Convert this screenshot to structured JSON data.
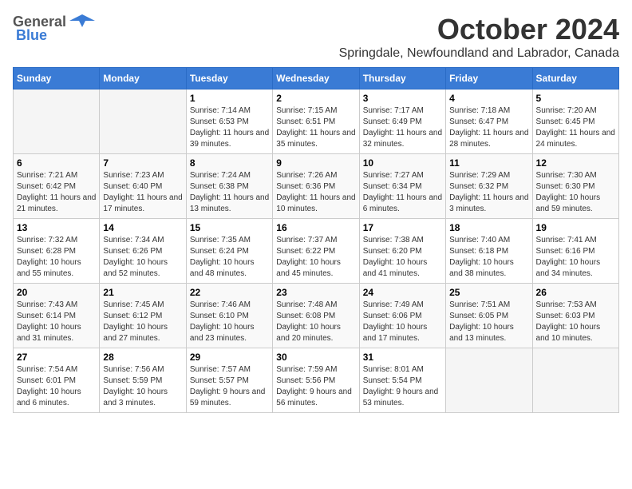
{
  "logo": {
    "general": "General",
    "blue": "Blue"
  },
  "title": "October 2024",
  "location": "Springdale, Newfoundland and Labrador, Canada",
  "days_header": [
    "Sunday",
    "Monday",
    "Tuesday",
    "Wednesday",
    "Thursday",
    "Friday",
    "Saturday"
  ],
  "weeks": [
    [
      {
        "day": "",
        "info": ""
      },
      {
        "day": "",
        "info": ""
      },
      {
        "day": "1",
        "info": "Sunrise: 7:14 AM\nSunset: 6:53 PM\nDaylight: 11 hours and 39 minutes."
      },
      {
        "day": "2",
        "info": "Sunrise: 7:15 AM\nSunset: 6:51 PM\nDaylight: 11 hours and 35 minutes."
      },
      {
        "day": "3",
        "info": "Sunrise: 7:17 AM\nSunset: 6:49 PM\nDaylight: 11 hours and 32 minutes."
      },
      {
        "day": "4",
        "info": "Sunrise: 7:18 AM\nSunset: 6:47 PM\nDaylight: 11 hours and 28 minutes."
      },
      {
        "day": "5",
        "info": "Sunrise: 7:20 AM\nSunset: 6:45 PM\nDaylight: 11 hours and 24 minutes."
      }
    ],
    [
      {
        "day": "6",
        "info": "Sunrise: 7:21 AM\nSunset: 6:42 PM\nDaylight: 11 hours and 21 minutes."
      },
      {
        "day": "7",
        "info": "Sunrise: 7:23 AM\nSunset: 6:40 PM\nDaylight: 11 hours and 17 minutes."
      },
      {
        "day": "8",
        "info": "Sunrise: 7:24 AM\nSunset: 6:38 PM\nDaylight: 11 hours and 13 minutes."
      },
      {
        "day": "9",
        "info": "Sunrise: 7:26 AM\nSunset: 6:36 PM\nDaylight: 11 hours and 10 minutes."
      },
      {
        "day": "10",
        "info": "Sunrise: 7:27 AM\nSunset: 6:34 PM\nDaylight: 11 hours and 6 minutes."
      },
      {
        "day": "11",
        "info": "Sunrise: 7:29 AM\nSunset: 6:32 PM\nDaylight: 11 hours and 3 minutes."
      },
      {
        "day": "12",
        "info": "Sunrise: 7:30 AM\nSunset: 6:30 PM\nDaylight: 10 hours and 59 minutes."
      }
    ],
    [
      {
        "day": "13",
        "info": "Sunrise: 7:32 AM\nSunset: 6:28 PM\nDaylight: 10 hours and 55 minutes."
      },
      {
        "day": "14",
        "info": "Sunrise: 7:34 AM\nSunset: 6:26 PM\nDaylight: 10 hours and 52 minutes."
      },
      {
        "day": "15",
        "info": "Sunrise: 7:35 AM\nSunset: 6:24 PM\nDaylight: 10 hours and 48 minutes."
      },
      {
        "day": "16",
        "info": "Sunrise: 7:37 AM\nSunset: 6:22 PM\nDaylight: 10 hours and 45 minutes."
      },
      {
        "day": "17",
        "info": "Sunrise: 7:38 AM\nSunset: 6:20 PM\nDaylight: 10 hours and 41 minutes."
      },
      {
        "day": "18",
        "info": "Sunrise: 7:40 AM\nSunset: 6:18 PM\nDaylight: 10 hours and 38 minutes."
      },
      {
        "day": "19",
        "info": "Sunrise: 7:41 AM\nSunset: 6:16 PM\nDaylight: 10 hours and 34 minutes."
      }
    ],
    [
      {
        "day": "20",
        "info": "Sunrise: 7:43 AM\nSunset: 6:14 PM\nDaylight: 10 hours and 31 minutes."
      },
      {
        "day": "21",
        "info": "Sunrise: 7:45 AM\nSunset: 6:12 PM\nDaylight: 10 hours and 27 minutes."
      },
      {
        "day": "22",
        "info": "Sunrise: 7:46 AM\nSunset: 6:10 PM\nDaylight: 10 hours and 23 minutes."
      },
      {
        "day": "23",
        "info": "Sunrise: 7:48 AM\nSunset: 6:08 PM\nDaylight: 10 hours and 20 minutes."
      },
      {
        "day": "24",
        "info": "Sunrise: 7:49 AM\nSunset: 6:06 PM\nDaylight: 10 hours and 17 minutes."
      },
      {
        "day": "25",
        "info": "Sunrise: 7:51 AM\nSunset: 6:05 PM\nDaylight: 10 hours and 13 minutes."
      },
      {
        "day": "26",
        "info": "Sunrise: 7:53 AM\nSunset: 6:03 PM\nDaylight: 10 hours and 10 minutes."
      }
    ],
    [
      {
        "day": "27",
        "info": "Sunrise: 7:54 AM\nSunset: 6:01 PM\nDaylight: 10 hours and 6 minutes."
      },
      {
        "day": "28",
        "info": "Sunrise: 7:56 AM\nSunset: 5:59 PM\nDaylight: 10 hours and 3 minutes."
      },
      {
        "day": "29",
        "info": "Sunrise: 7:57 AM\nSunset: 5:57 PM\nDaylight: 9 hours and 59 minutes."
      },
      {
        "day": "30",
        "info": "Sunrise: 7:59 AM\nSunset: 5:56 PM\nDaylight: 9 hours and 56 minutes."
      },
      {
        "day": "31",
        "info": "Sunrise: 8:01 AM\nSunset: 5:54 PM\nDaylight: 9 hours and 53 minutes."
      },
      {
        "day": "",
        "info": ""
      },
      {
        "day": "",
        "info": ""
      }
    ]
  ]
}
